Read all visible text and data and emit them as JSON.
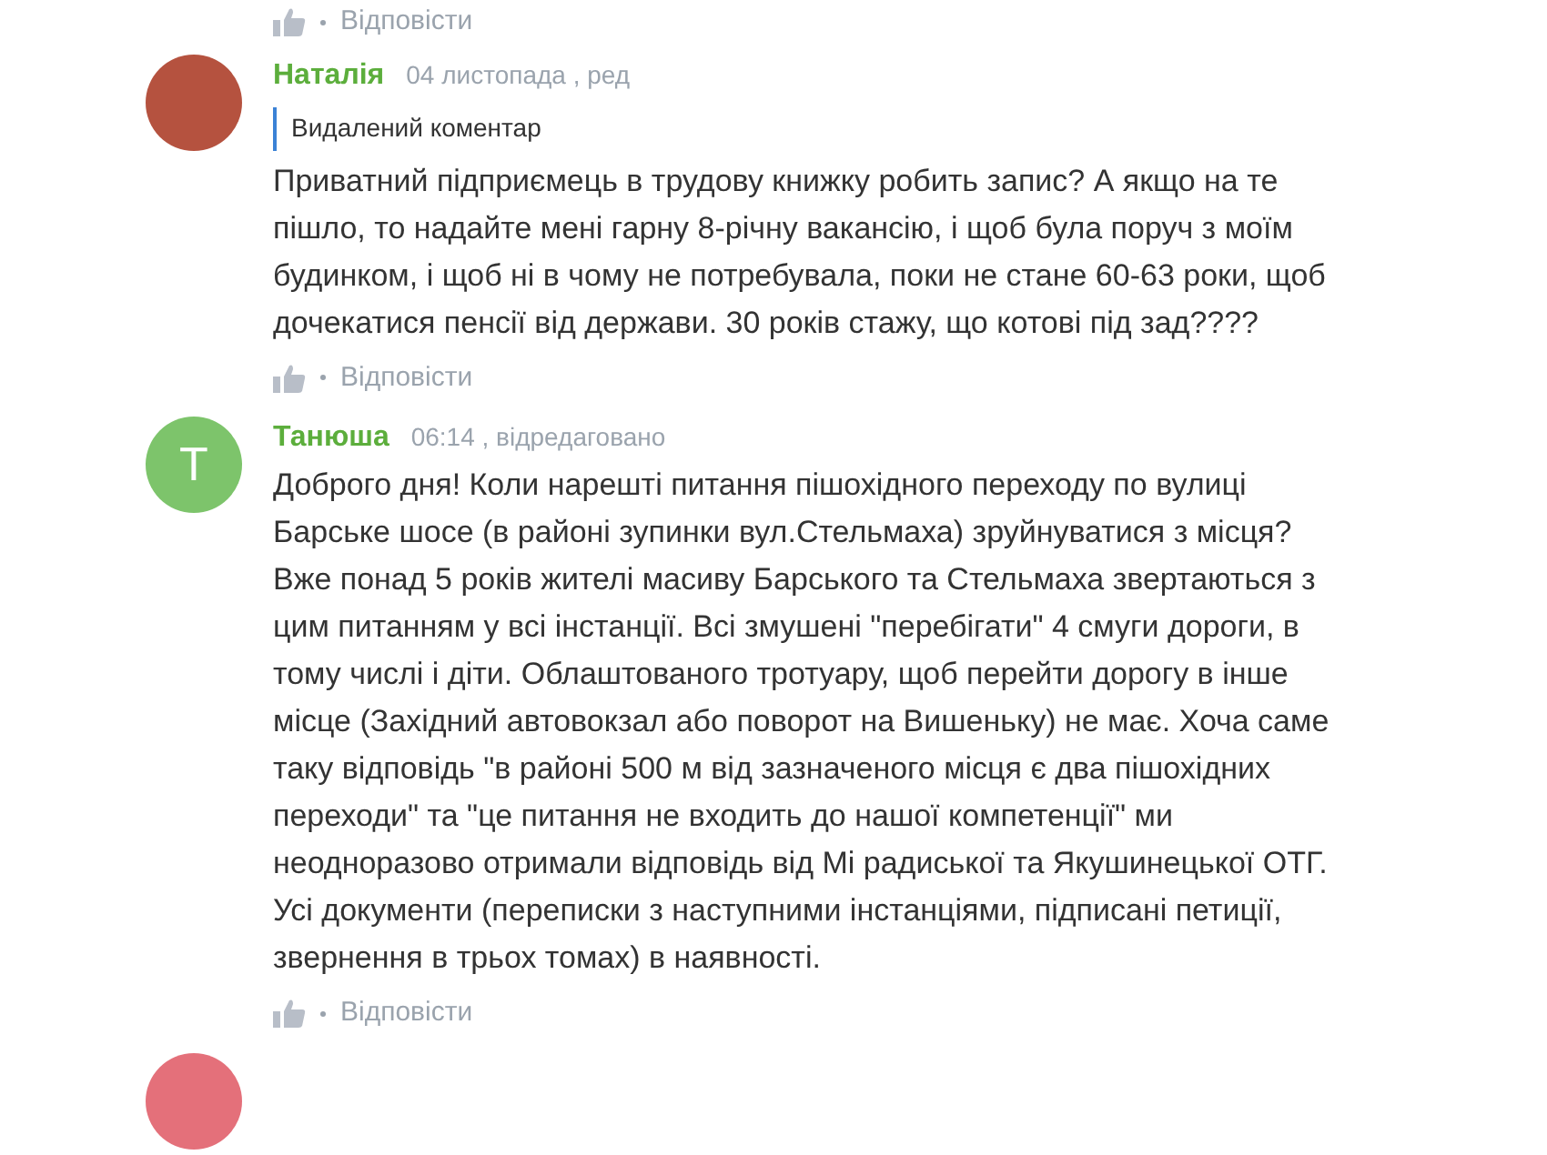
{
  "top_action": {
    "reply": "Відповісти"
  },
  "comments": [
    {
      "avatar": {
        "kind": "photo"
      },
      "author": "Наталія",
      "meta": "04 листопада , ред",
      "quote": "Видалений коментар",
      "text": "Приватний підприємець в трудову книжку робить запис? А якщо на те пішло, то надайте мені гарну 8-річну вакансію, і щоб була поруч з моїм будинком, і щоб ні в чому не потребувала, поки не стане 60-63 роки, щоб дочекатися пенсії від держави. 30 років стажу, що котові під зад????",
      "reply": "Відповісти"
    },
    {
      "avatar": {
        "kind": "letter",
        "letter": "Т",
        "color": "#7dc46b"
      },
      "author": "Танюша",
      "meta": "06:14 , відредаговано",
      "text": "Доброго дня! Коли нарешті питання пішохідного переходу по вулиці Барське шосе (в районі зупинки вул.Стельмаха) зруйнуватися з місця? Вже понад 5 років жителі масиву Барського та Стельмаха звертаються з цим питанням у всі інстанції. Всі змушені \"перебігати\" 4 смуги дороги, в тому числі і діти. Облаштованого тротуару, щоб перейти дорогу в інше місце (Західний автовокзал або поворот на Вишеньку) не має. Хоча саме таку відповідь \"в районі 500 м від зазначеного місця є два пішохідних переходи\" та \"це питання не входить до нашої компетенції\" ми неодноразово отримали відповідь від Мі радиської та Якушинецької ОТГ. Усі документи (переписки з наступними інстанціями, підписані петиції, звернення в трьох томах) в наявності.",
      "reply": "Відповісти"
    },
    {
      "avatar": {
        "kind": "letter",
        "color": "#e4707a"
      }
    }
  ]
}
